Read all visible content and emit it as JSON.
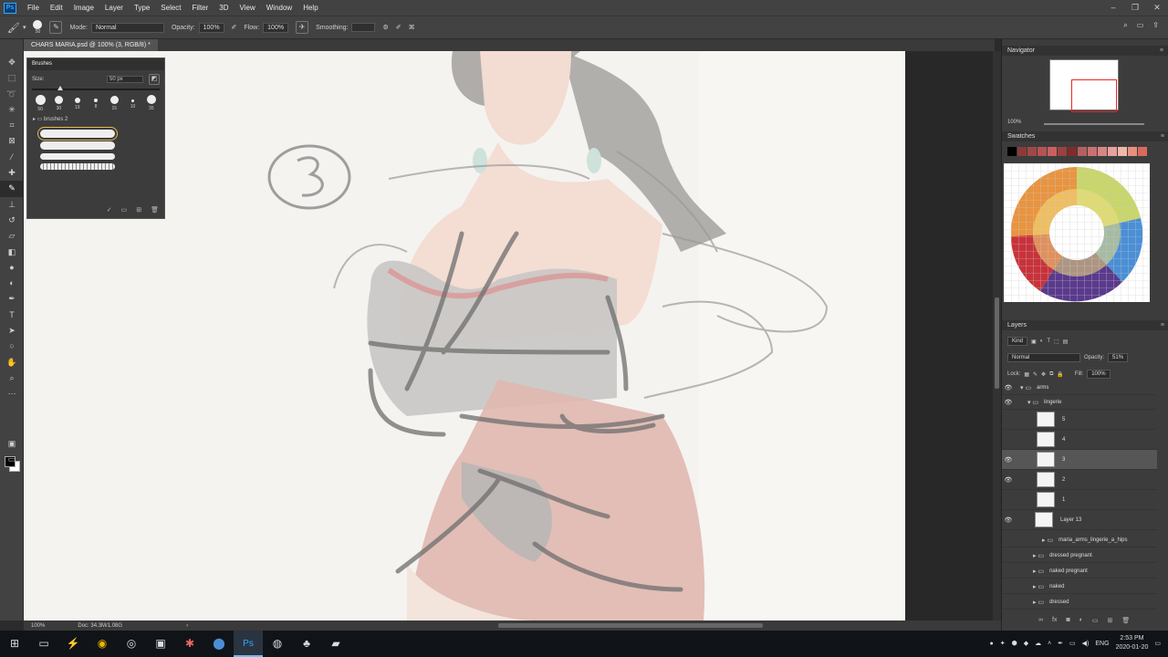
{
  "menubar": {
    "items": [
      "File",
      "Edit",
      "Image",
      "Layer",
      "Type",
      "Select",
      "Filter",
      "3D",
      "View",
      "Window",
      "Help"
    ],
    "app": "Ps"
  },
  "options": {
    "size": "50",
    "mode_label": "Mode:",
    "mode_value": "Normal",
    "opacity_label": "Opacity:",
    "opacity_value": "100%",
    "flow_label": "Flow:",
    "flow_value": "100%",
    "smoothing_label": "Smoothing:"
  },
  "document": {
    "tab_title": "CHARS MARIA.psd @ 100% (3, RGB/8) *",
    "zoom": "100%",
    "doc_info": "Doc: 34.3M/1.08G"
  },
  "brushes": {
    "title": "Brushes",
    "size_label": "Size:",
    "size_value": "50 px",
    "presets": [
      "50",
      "30",
      "19",
      "8",
      "15",
      "10",
      "35"
    ],
    "folder": "brushes 2"
  },
  "navigator": {
    "title": "Navigator",
    "zoom": "100%"
  },
  "swatches": {
    "title": "Swatches",
    "colors": [
      "#000000",
      "#8c3a3a",
      "#a04848",
      "#b55353",
      "#c96060",
      "#9a4040",
      "#7f2c2c",
      "#b46060",
      "#c97070",
      "#d98585",
      "#e8a0a0",
      "#f0b8a8",
      "#e89080",
      "#d96a5a"
    ]
  },
  "layers": {
    "title": "Layers",
    "kind": "Kind",
    "blend": "Normal",
    "opacity_label": "Opacity:",
    "opacity_value": "51%",
    "lock_label": "Lock:",
    "fill_label": "Fill:",
    "fill_value": "100%",
    "items": [
      {
        "name": "arms",
        "type": "group"
      },
      {
        "name": "lingerie",
        "type": "group"
      },
      {
        "name": "5",
        "type": "layer"
      },
      {
        "name": "4",
        "type": "layer"
      },
      {
        "name": "3",
        "type": "layer"
      },
      {
        "name": "2",
        "type": "layer"
      },
      {
        "name": "1",
        "type": "layer"
      },
      {
        "name": "Layer 13",
        "type": "layer"
      },
      {
        "name": "maria_arms_lingerie_a_hips",
        "type": "group"
      },
      {
        "name": "dressed pregnant",
        "type": "group"
      },
      {
        "name": "naked pregnant",
        "type": "group"
      },
      {
        "name": "naked",
        "type": "group"
      },
      {
        "name": "dressed",
        "type": "group"
      }
    ]
  },
  "taskbar": {
    "lang": "ENG",
    "time": "2:53 PM",
    "date": "2020-01-20"
  }
}
